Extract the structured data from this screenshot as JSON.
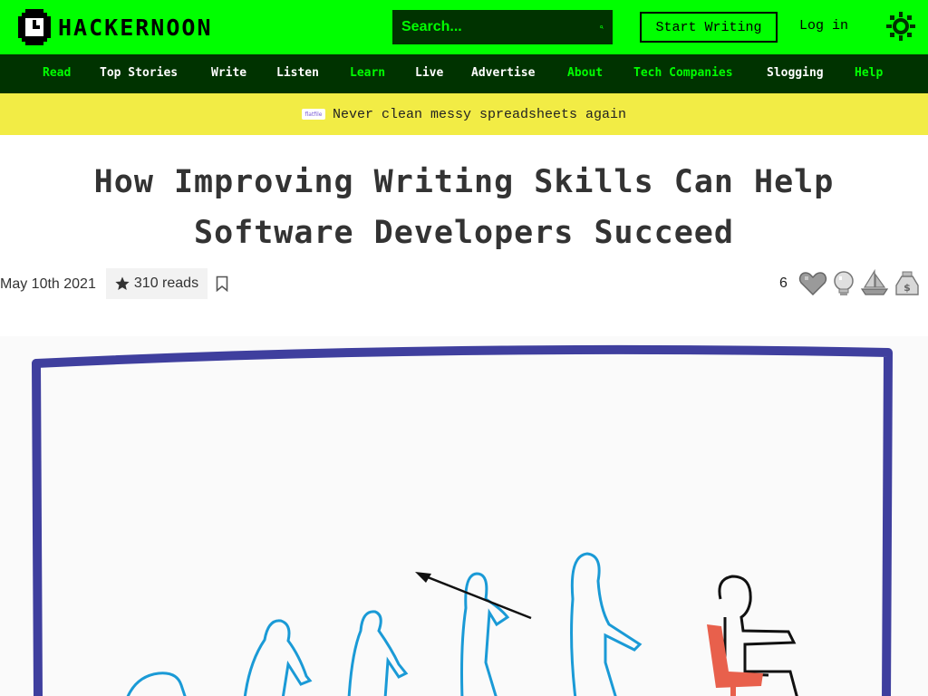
{
  "header": {
    "logo_text": "HACKERNOON",
    "search_placeholder": "Search...",
    "start_writing": "Start Writing",
    "login": "Log in"
  },
  "nav": {
    "items": [
      {
        "label": "Read"
      },
      {
        "label": "Top Stories"
      },
      {
        "label": "Write"
      },
      {
        "label": "Listen"
      },
      {
        "label": "Learn"
      },
      {
        "label": "Live"
      },
      {
        "label": "Advertise"
      },
      {
        "label": "About"
      },
      {
        "label": "Tech Companies"
      },
      {
        "label": "Slogging"
      },
      {
        "label": "Help"
      }
    ]
  },
  "banner": {
    "sponsor": "flatfile",
    "text": "Never clean messy spreadsheets again"
  },
  "article": {
    "title_line1": "How Improving Writing Skills Can Help",
    "title_line2": "Software Developers Succeed",
    "date": "May 10th 2021",
    "reads": "310 reads",
    "reaction_count": "6"
  },
  "colors": {
    "brand_green": "#00ff00",
    "dark_green": "#003300",
    "banner_yellow": "#f2ec45",
    "frame_blue": "#3f3f9e",
    "figure_blue": "#1a9ad6",
    "chair_red": "#e8604c"
  },
  "icons": [
    "logo-icon",
    "search-icon",
    "sun-icon",
    "star-icon",
    "bookmark-icon",
    "heart-icon",
    "lightbulb-icon",
    "boat-icon",
    "money-bag-icon"
  ]
}
